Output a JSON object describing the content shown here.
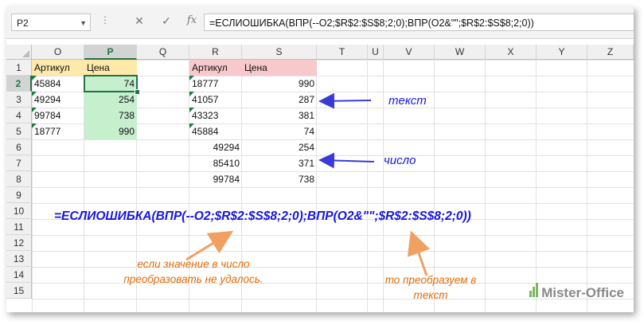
{
  "formula_bar": {
    "name_box": "P2",
    "cancel_icon": "✕",
    "enter_icon": "✓",
    "fx_label": "fx",
    "formula": "=ЕСЛИОШИБКА(ВПР(--O2;$R$2:$S$8;2;0);ВПР(O2&\"\";$R$2:$S$8;2;0))"
  },
  "columns": [
    "O",
    "P",
    "Q",
    "R",
    "S",
    "T",
    "U",
    "V",
    "W",
    "X",
    "Y",
    "Z"
  ],
  "selected_column": "P",
  "rows": [
    "1",
    "2",
    "3",
    "4",
    "5",
    "6",
    "7",
    "8",
    "9",
    "10",
    "11",
    "12",
    "13",
    "14",
    "15"
  ],
  "selected_row": "2",
  "left_table": {
    "header_article": "Артикул",
    "header_price": "Цена",
    "articles": [
      "45884",
      "49294",
      "99784",
      "18777"
    ],
    "prices": [
      "74",
      "254",
      "738",
      "990"
    ]
  },
  "right_table": {
    "header_article": "Артикул",
    "header_price": "Цена",
    "text_articles": [
      "18777",
      "41057",
      "43323",
      "45884"
    ],
    "number_articles": [
      "49294",
      "85410",
      "99784"
    ],
    "prices": [
      "990",
      "287",
      "381",
      "74",
      "254",
      "371",
      "738"
    ]
  },
  "annotations": {
    "text_label": "текст",
    "number_label": "число",
    "big_formula": "=ЕСЛИОШИБКА(ВПР(--O2;$R$2:$S$8;2;0);ВПР(O2&\"\";$R$2:$S$8;2;0))",
    "note_left_1": "если значение в число",
    "note_left_2": "преобразовать не удалось.",
    "note_right_1": "то преобразуем в",
    "note_right_2": "текст"
  },
  "logo": {
    "text": "Mister-Office"
  },
  "colors": {
    "accent_green": "#217346",
    "annotation_blue": "#1515e8",
    "annotation_orange": "#e26b0a",
    "header_yellow": "#fde9a9",
    "header_pink": "#f8c9cc",
    "cell_green": "#c6efce"
  }
}
